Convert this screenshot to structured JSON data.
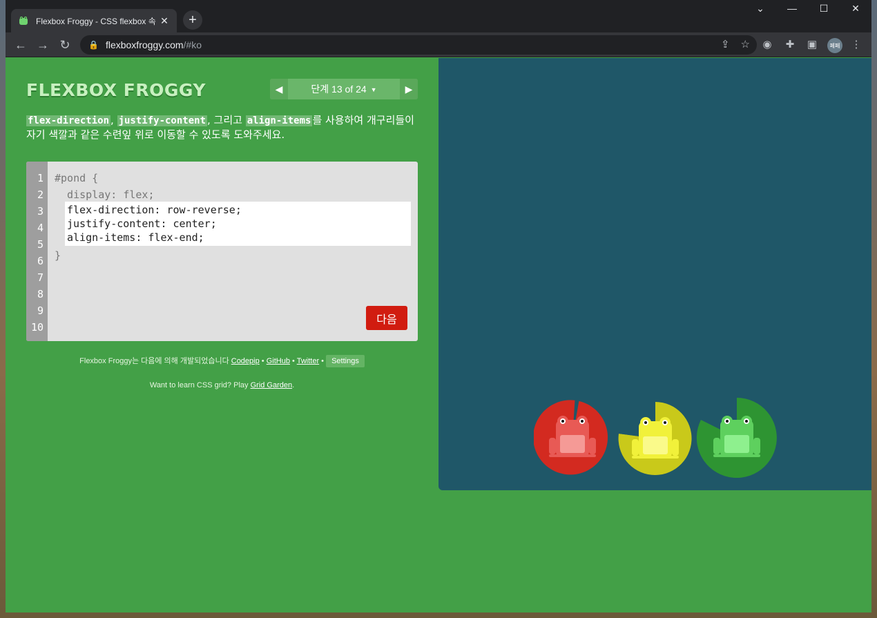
{
  "browser": {
    "tab_title": "Flexbox Froggy - CSS flexbox 속",
    "tab_close": "✕",
    "new_tab": "+",
    "url_host": "flexboxfroggy.com",
    "url_path": "/#ko",
    "avatar_text": "페페",
    "window_controls": {
      "dropdown": "⌄",
      "minimize": "—",
      "maximize": "☐",
      "close": "✕"
    }
  },
  "header": {
    "logo": "FLEXBOX FROGGY",
    "level_prev": "◀",
    "level_next": "▶",
    "level_label": "단계 13 of 24",
    "level_caret": "▼"
  },
  "instructions": {
    "code1": "flex-direction",
    "sep1": ", ",
    "code2": "justify-content",
    "sep2": ", 그리고 ",
    "code3": "align-items",
    "rest": "를 사용하여 개구리들이 자기 색깔과 같은 수련잎 위로 이동할 수 있도록 도와주세요."
  },
  "editor": {
    "line_numbers": [
      "1",
      "2",
      "3",
      "4",
      "5",
      "6",
      "7",
      "8",
      "9",
      "10"
    ],
    "line1": "#pond {",
    "line2": "  display: flex;",
    "input_lines": [
      "flex-direction: row-reverse;",
      "justify-content: center;",
      "align-items: flex-end;"
    ],
    "close": "}",
    "next_button": "다음"
  },
  "credits": {
    "prefix": "Flexbox Froggy는 다음에 의해 개발되었습니다 ",
    "codepip": "Codepip",
    "bullet": " • ",
    "github": "GitHub",
    "twitter": "Twitter",
    "settings": "Settings",
    "grid_prefix": "Want to learn CSS grid? Play ",
    "grid_garden": "Grid Garden",
    "grid_suffix": "."
  },
  "pond": {
    "frogs": [
      "red",
      "yellow",
      "green"
    ],
    "colors": {
      "red": "#d32a20",
      "yellow": "#c9c91a",
      "green": "#2e9432",
      "pond": "#1f5768"
    }
  }
}
